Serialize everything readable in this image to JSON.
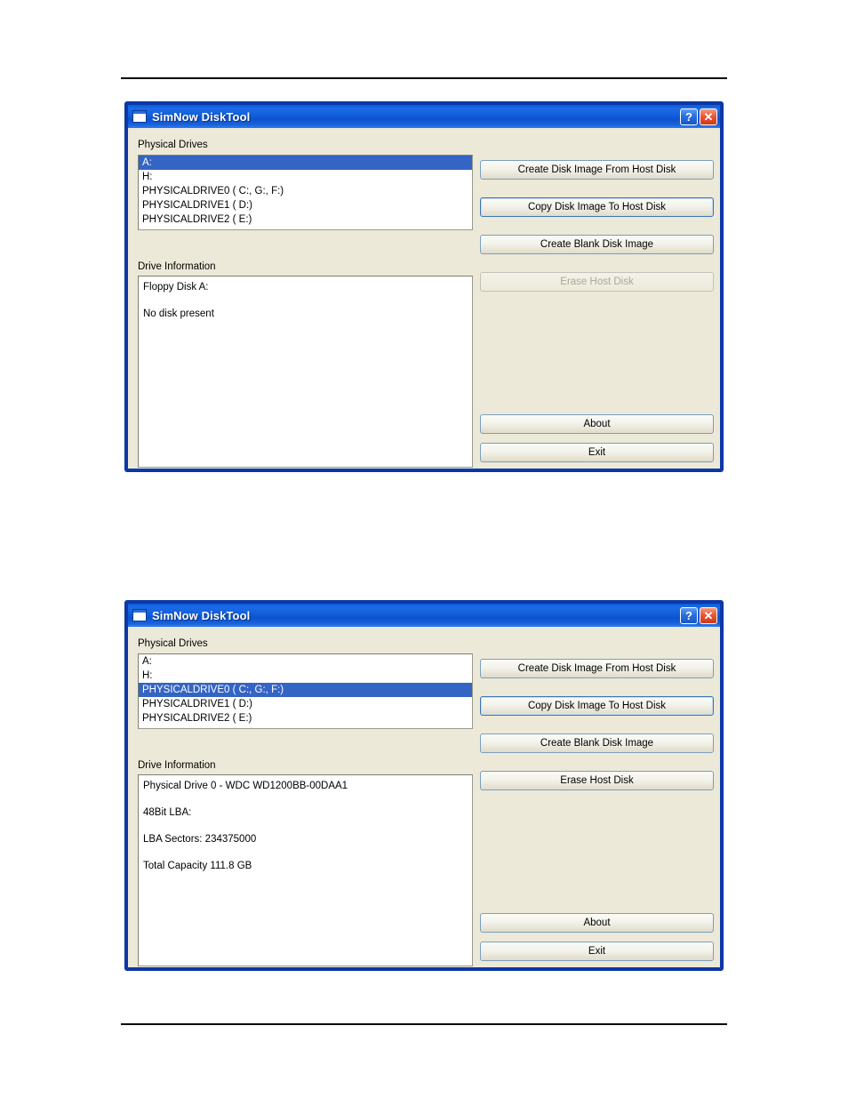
{
  "page": {
    "rules": [
      "top-rule",
      "bottom-rule"
    ]
  },
  "dialog1": {
    "title": "SimNow DiskTool",
    "icon": "window-icon",
    "titlebar_buttons": {
      "help": "?",
      "close": "✕"
    },
    "groups": {
      "physical_drives_label": "Physical Drives",
      "drive_information_label": "Drive Information"
    },
    "drives": [
      {
        "label": "A:",
        "selected": true
      },
      {
        "label": "H:",
        "selected": false
      },
      {
        "label": "PHYSICALDRIVE0 ( C:, G:, F:)",
        "selected": false
      },
      {
        "label": "PHYSICALDRIVE1 ( D:)",
        "selected": false
      },
      {
        "label": "PHYSICALDRIVE2 ( E:)",
        "selected": false
      }
    ],
    "drive_information": [
      "Floppy Disk A:",
      "",
      "No disk present"
    ],
    "buttons": {
      "create_from_host": "Create Disk Image From Host Disk",
      "copy_to_host": "Copy Disk Image To Host Disk",
      "create_blank": "Create Blank Disk Image",
      "erase_host": "Erase Host Disk",
      "about": "About",
      "exit": "Exit"
    },
    "button_states": {
      "create_from_host": "enabled",
      "copy_to_host": "focused",
      "create_blank": "enabled",
      "erase_host": "disabled",
      "about": "enabled",
      "exit": "enabled"
    }
  },
  "dialog2": {
    "title": "SimNow DiskTool",
    "icon": "window-icon",
    "titlebar_buttons": {
      "help": "?",
      "close": "✕"
    },
    "groups": {
      "physical_drives_label": "Physical Drives",
      "drive_information_label": "Drive Information"
    },
    "drives": [
      {
        "label": "A:",
        "selected": false
      },
      {
        "label": "H:",
        "selected": false
      },
      {
        "label": "PHYSICALDRIVE0 ( C:, G:, F:)",
        "selected": true
      },
      {
        "label": "PHYSICALDRIVE1 ( D:)",
        "selected": false
      },
      {
        "label": "PHYSICALDRIVE2 ( E:)",
        "selected": false
      }
    ],
    "drive_information": [
      "Physical Drive 0 - WDC WD1200BB-00DAA1",
      "",
      "48Bit LBA:",
      "",
      "LBA Sectors: 234375000",
      "",
      "Total Capacity 111.8 GB"
    ],
    "buttons": {
      "create_from_host": "Create Disk Image From Host Disk",
      "copy_to_host": "Copy Disk Image To Host Disk",
      "create_blank": "Create Blank Disk Image",
      "erase_host": "Erase Host Disk",
      "about": "About",
      "exit": "Exit"
    },
    "button_states": {
      "create_from_host": "enabled",
      "copy_to_host": "focused",
      "create_blank": "enabled",
      "erase_host": "enabled",
      "about": "enabled",
      "exit": "enabled"
    }
  },
  "colors": {
    "titlebar_blue": "#1360dd",
    "window_border": "#0b39a8",
    "dialog_face": "#ece9d8",
    "selection_blue": "#3464c4",
    "close_red": "#cf3717",
    "button_border": "#7b9ebd"
  }
}
